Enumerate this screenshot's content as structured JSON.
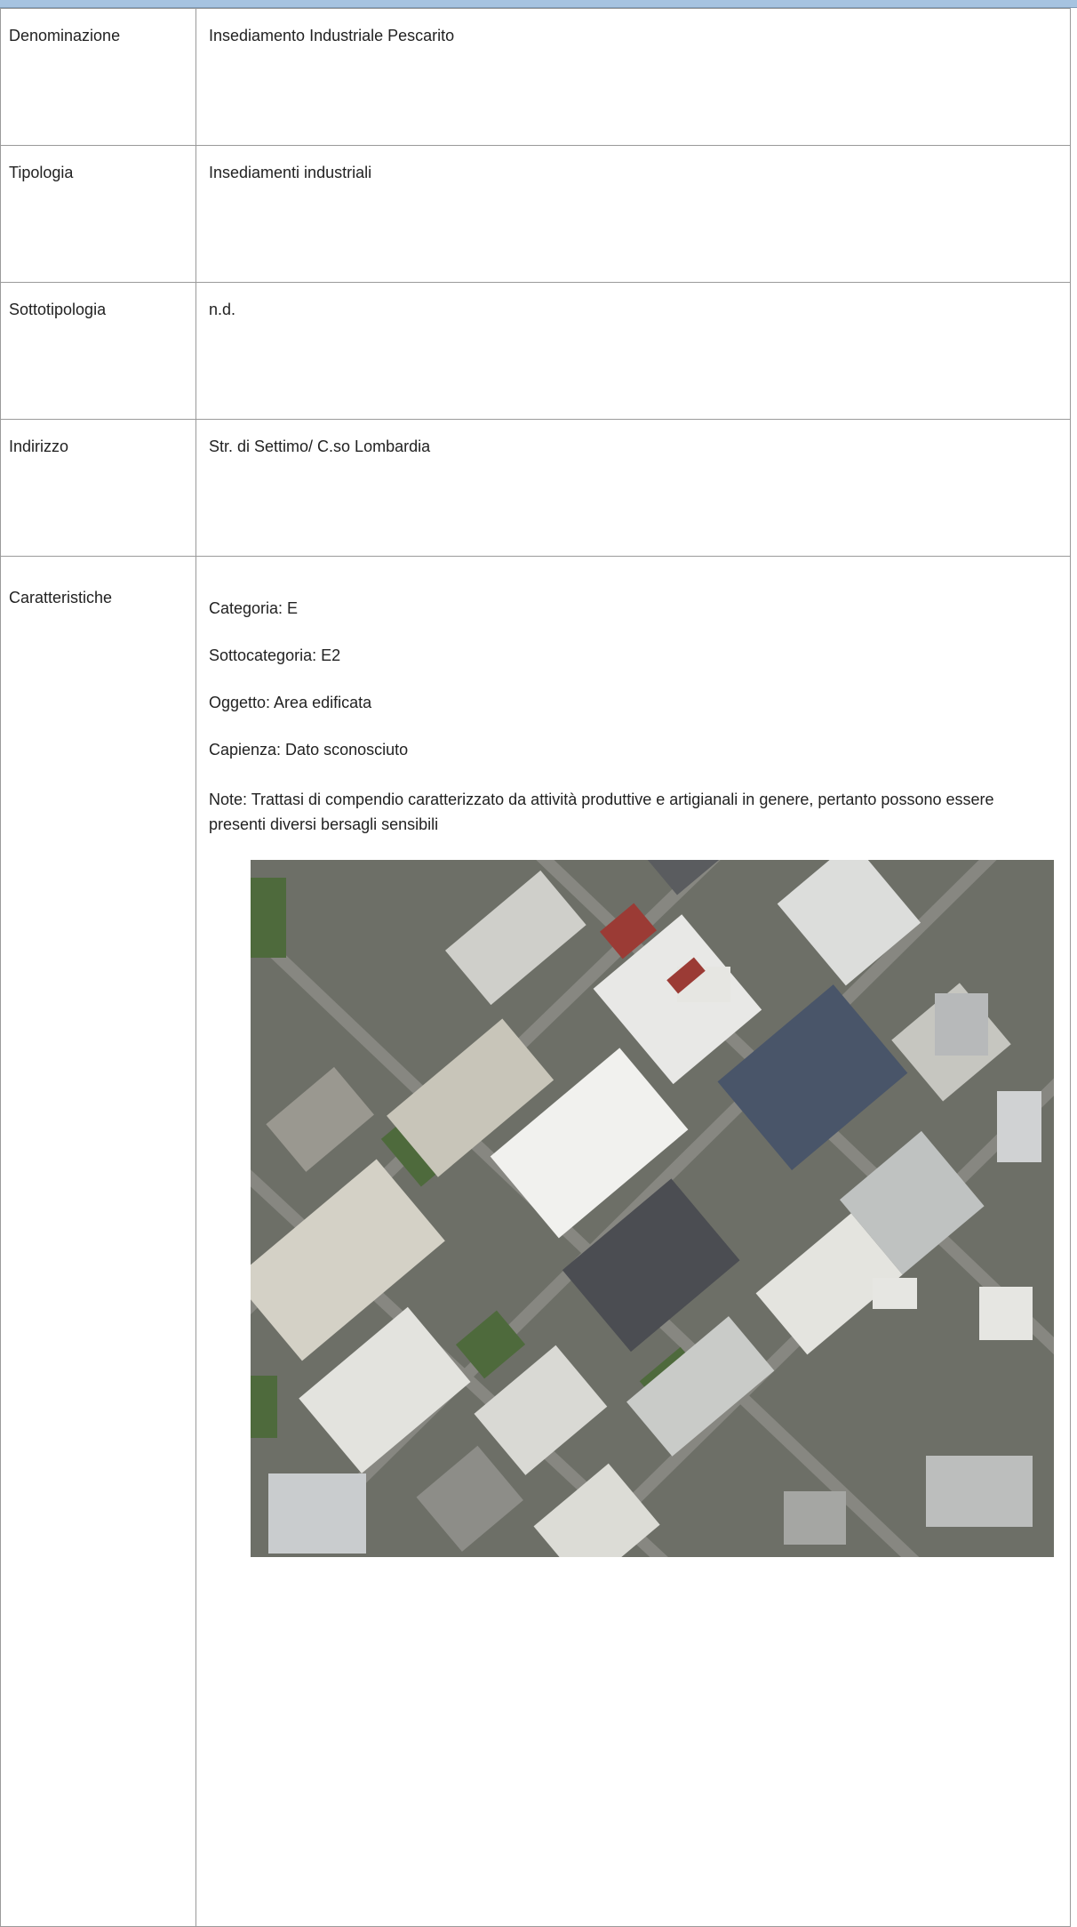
{
  "rows": [
    {
      "label": "Denominazione",
      "value": "Insediamento Industriale Pescarito"
    },
    {
      "label": "Tipologia",
      "value": "Insediamenti industriali"
    },
    {
      "label": "Sottotipologia",
      "value": "n.d."
    },
    {
      "label": "Indirizzo",
      "value": "Str. di Settimo/ C.so Lombardia"
    }
  ],
  "caratteristiche": {
    "label": "Caratteristiche",
    "categoria": "Categoria: E",
    "sottocategoria": "Sottocategoria: E2",
    "oggetto": "Oggetto: Area edificata",
    "capienza": "Capienza: Dato sconosciuto",
    "note": "Note: Trattasi di compendio caratterizzato da attività produttive e artigianali in genere, pertanto possono essere presenti diversi bersagli sensibili"
  },
  "colors": {
    "header_bar": "#a6c3e0",
    "border": "#9a9a9a"
  },
  "image": {
    "icon": "aerial-photo-industrial-area"
  }
}
